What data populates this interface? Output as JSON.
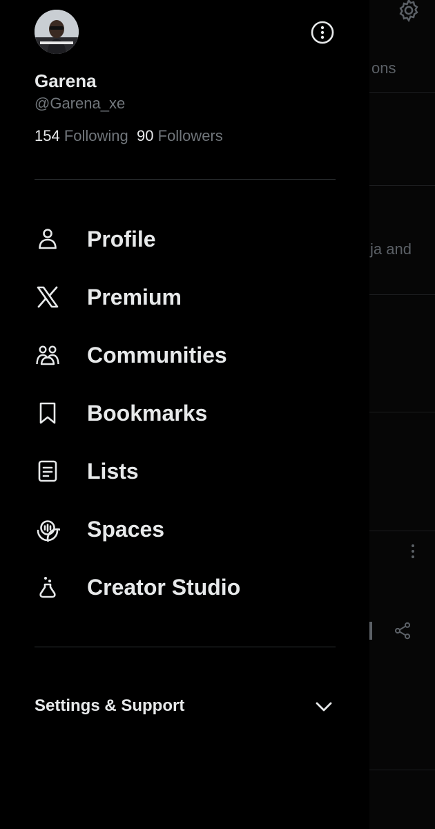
{
  "profile": {
    "name": "Garena",
    "handle": "@Garena_xe",
    "following_count": "154",
    "following_label": "Following",
    "followers_count": "90",
    "followers_label": "Followers"
  },
  "menu": [
    {
      "label": "Profile",
      "icon": "person-icon"
    },
    {
      "label": "Premium",
      "icon": "x-logo-icon"
    },
    {
      "label": "Communities",
      "icon": "communities-icon"
    },
    {
      "label": "Bookmarks",
      "icon": "bookmark-icon"
    },
    {
      "label": "Lists",
      "icon": "list-icon"
    },
    {
      "label": "Spaces",
      "icon": "spaces-icon"
    },
    {
      "label": "Creator Studio",
      "icon": "flask-icon"
    }
  ],
  "settings": {
    "label": "Settings & Support"
  },
  "background": {
    "tab_fragment": "ons",
    "post_fragment": "ja and"
  }
}
